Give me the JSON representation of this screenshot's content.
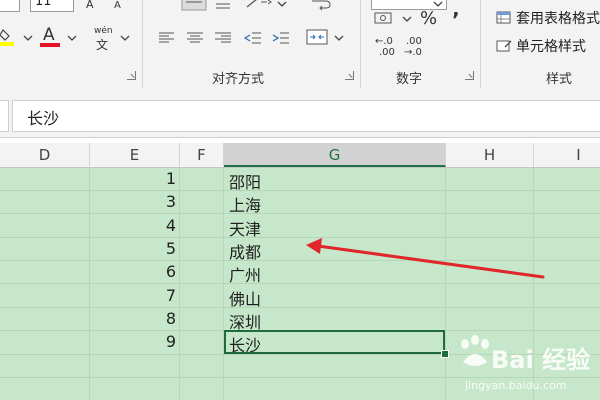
{
  "ribbon": {
    "font_size_value": "11",
    "wen_label": "wén",
    "wen_char": "文",
    "align_group_label": "对齐方式",
    "number_group_label": "数字",
    "percent_symbol": "%",
    "comma_symbol": "’",
    "inc_decimal_top": "←.0",
    "inc_decimal_bottom": ".00",
    "dec_decimal_top": ".00",
    "dec_decimal_bottom": "→.0",
    "table_format_label": "套用表格格式",
    "cell_style_label": "单元格样式",
    "style_group_label": "样式"
  },
  "formula_bar": {
    "value": "长沙"
  },
  "grid": {
    "columns": [
      "D",
      "E",
      "F",
      "G",
      "H",
      "I"
    ],
    "selected_column": "G",
    "rows": [
      {
        "num": "1",
        "city": "邵阳"
      },
      {
        "num": "3",
        "city": "上海"
      },
      {
        "num": "4",
        "city": "天津"
      },
      {
        "num": "5",
        "city": "成都"
      },
      {
        "num": "6",
        "city": "广州"
      },
      {
        "num": "7",
        "city": "佛山"
      },
      {
        "num": "8",
        "city": "深圳"
      },
      {
        "num": "9",
        "city": "长沙"
      }
    ]
  },
  "watermark": {
    "brand": "Bai 经验",
    "url": "jingyan.baidu.com"
  },
  "colors": {
    "accent": "#217346",
    "sheet_fill": "#c6e7c9",
    "arrow": "#e0262a",
    "font_color_bar": "#e81123",
    "highlight_bar": "#ffff00"
  }
}
